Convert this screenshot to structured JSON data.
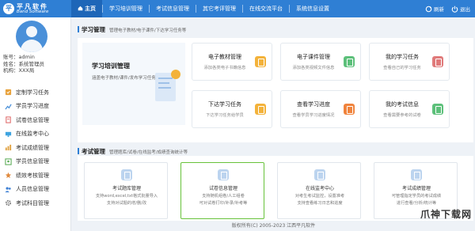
{
  "brand": {
    "cn": "平凡软件",
    "en": "Band Software",
    "mark": "平"
  },
  "nav": [
    {
      "label": "主页",
      "active": true
    },
    {
      "label": "学习培训管理"
    },
    {
      "label": "考试信息管理"
    },
    {
      "label": "其它考评管理"
    },
    {
      "label": "在线交流平台"
    },
    {
      "label": "系统信息设置"
    }
  ],
  "top_right": {
    "refresh": "刷新",
    "exit": "退出"
  },
  "user": {
    "account": "账号：admin",
    "name": "姓名：系统管理员",
    "org": "机构：XXX局"
  },
  "menu": [
    {
      "label": "定制学习任务",
      "color": "#e8a23c"
    },
    {
      "label": "学员学习进度",
      "color": "#4a90d9"
    },
    {
      "label": "试卷信息管理",
      "color": "#e06c6c"
    },
    {
      "label": "在线监考中心",
      "color": "#3fa4e0"
    },
    {
      "label": "考试成绩管理",
      "color": "#e0a03c"
    },
    {
      "label": "学员信息管理",
      "color": "#5fae5a"
    },
    {
      "label": "绩效考核管理",
      "color": "#e0893c"
    },
    {
      "label": "人员信息管理",
      "color": "#3c7fd4"
    },
    {
      "label": "考试科目管理",
      "color": "#777777"
    }
  ],
  "study": {
    "title": "学习管理",
    "subtitle": "管理电子教材/电子课件/下达学习任务等",
    "hero_title": "学习培训管理",
    "hero_desc": "涵盖电子教材/课件/发布学习任务...",
    "cards": [
      {
        "title": "电子教材管理",
        "desc": "添加各类电子书籍信息",
        "color": "#f3b23a"
      },
      {
        "title": "电子课件管理",
        "desc": "添加各类视频文件信息",
        "color": "#5cc07a"
      },
      {
        "title": "我的学习任务",
        "desc": "查看自己的学习任务",
        "color": "#e07a7a"
      },
      {
        "title": "下达学习任务",
        "desc": "下达学习任务给学员",
        "color": "#f3b23a"
      },
      {
        "title": "查看学习进度",
        "desc": "查看学员学习进度情况",
        "color": "#f0833c"
      },
      {
        "title": "我的考试信息",
        "desc": "查看需要参考的试卷",
        "color": "#5cc07a"
      }
    ]
  },
  "exam": {
    "title": "考试管理",
    "subtitle": "管理题库/试卷/在线监考/成绩查询统计等",
    "cards": [
      {
        "title": "考试题库管理",
        "desc": "支持word,excel,txt格式批量导入\n支持对试题的增/删/改"
      },
      {
        "title": "试卷信息管理",
        "desc": "支持随机组卷/人工组卷\n可对试卷打印/补录/补考等"
      },
      {
        "title": "在线监考中心",
        "desc": "对考生考试监控，设置准考\n支持查看练习日志和进度"
      },
      {
        "title": "考试成绩管理",
        "desc": "可管理指定学员的考试成绩\n进行查看/分析/统计等"
      }
    ]
  },
  "footer": "版权所有(C) 2005-2023 江西平凡软件",
  "watermark": "爪神下载网"
}
